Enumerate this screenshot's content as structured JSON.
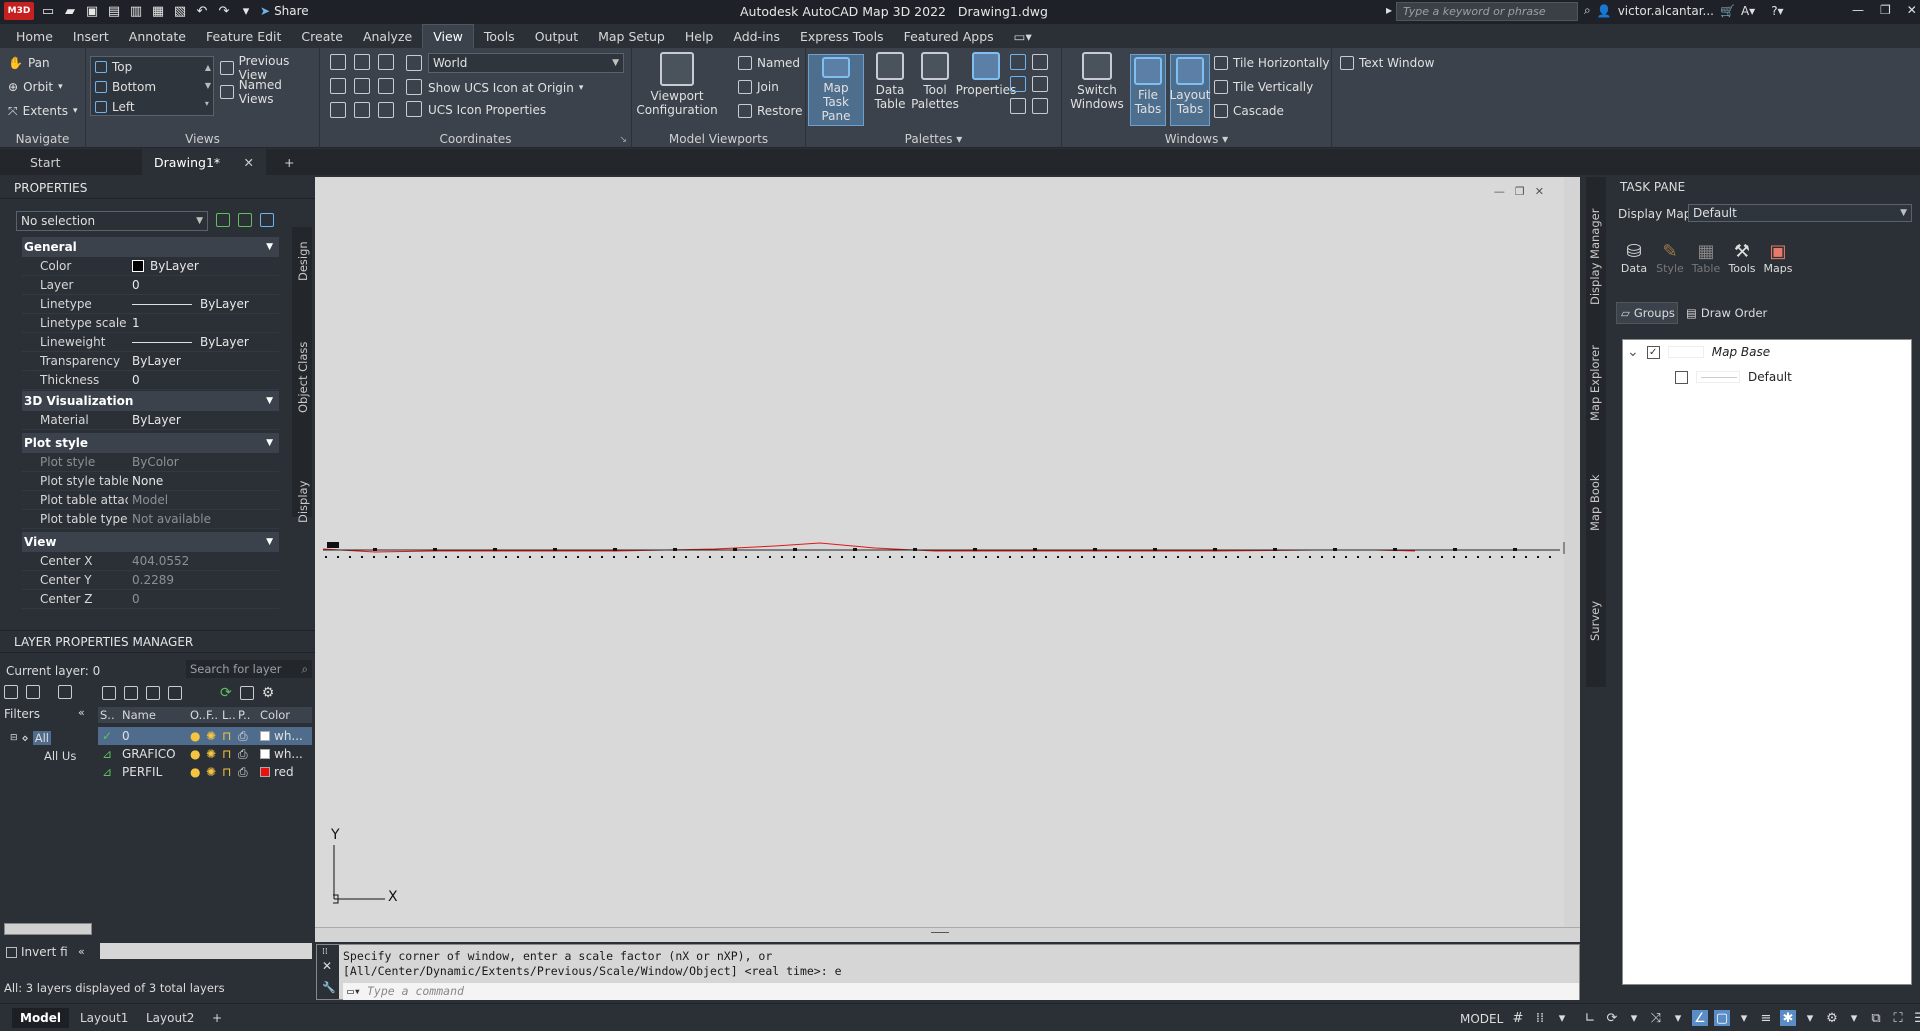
{
  "title_bar": {
    "logo": "M3D",
    "share_label": "Share",
    "window_title": "Autodesk AutoCAD Map 3D 2022",
    "file_name": "Drawing1.dwg",
    "search_placeholder": "Type a keyword or phrase",
    "user_name": "victor.alcantar..."
  },
  "menu": {
    "items": [
      "Home",
      "Insert",
      "Annotate",
      "Feature Edit",
      "Create",
      "Analyze",
      "View",
      "Tools",
      "Output",
      "Map Setup",
      "Help",
      "Add-ins",
      "Express Tools",
      "Featured Apps"
    ],
    "active": "View"
  },
  "ribbon": {
    "navigate": {
      "title": "Navigate",
      "pan": "Pan",
      "orbit": "Orbit",
      "extents": "Extents"
    },
    "views": {
      "title": "Views",
      "list": [
        "Top",
        "Bottom",
        "Left"
      ],
      "previous": "Previous View",
      "named": "Named Views"
    },
    "coordinates": {
      "title": "Coordinates",
      "ucs_value": "World",
      "show_ucs": "Show UCS Icon at Origin",
      "ucs_props": "UCS Icon Properties"
    },
    "model_viewports": {
      "title": "Model Viewports",
      "config": "Viewport Configuration",
      "named": "Named",
      "join": "Join",
      "restore": "Restore"
    },
    "palettes": {
      "title": "Palettes",
      "map_task_pane": "Map Task Pane",
      "data_table": "Data Table",
      "tool_palettes": "Tool Palettes",
      "properties": "Properties"
    },
    "windows": {
      "title": "Windows",
      "switch": "Switch Windows",
      "file_tabs": "File Tabs",
      "layout_tabs": "Layout Tabs",
      "tile_h": "Tile Horizontally",
      "tile_v": "Tile Vertically",
      "cascade": "Cascade",
      "text_window": "Text Window"
    }
  },
  "file_tabs": {
    "start": "Start",
    "active": "Drawing1*"
  },
  "properties": {
    "header": "PROPERTIES",
    "selection": "No selection",
    "side_tabs": [
      "Design",
      "Object Class",
      "Display"
    ],
    "sections": {
      "general": "General",
      "viz": "3D Visualization",
      "plot": "Plot style",
      "view": "View"
    },
    "general": [
      {
        "k": "Color",
        "v": "ByLayer"
      },
      {
        "k": "Layer",
        "v": "0"
      },
      {
        "k": "Linetype",
        "v": "ByLayer"
      },
      {
        "k": "Linetype scale",
        "v": "1"
      },
      {
        "k": "Lineweight",
        "v": "ByLayer"
      },
      {
        "k": "Transparency",
        "v": "ByLayer"
      },
      {
        "k": "Thickness",
        "v": "0"
      }
    ],
    "viz": [
      {
        "k": "Material",
        "v": "ByLayer"
      }
    ],
    "plot": [
      {
        "k": "Plot style",
        "v": "ByColor"
      },
      {
        "k": "Plot style table",
        "v": "None"
      },
      {
        "k": "Plot table attach...",
        "v": "Model"
      },
      {
        "k": "Plot table type",
        "v": "Not available"
      }
    ],
    "view": [
      {
        "k": "Center X",
        "v": "404.0552"
      },
      {
        "k": "Center Y",
        "v": "0.2289"
      },
      {
        "k": "Center Z",
        "v": "0"
      }
    ]
  },
  "layers": {
    "header": "LAYER PROPERTIES MANAGER",
    "current": "Current layer: 0",
    "search_placeholder": "Search for layer",
    "filters_label": "Filters",
    "tree": [
      "All",
      "All Us"
    ],
    "columns": [
      "S..",
      "Name",
      "O..",
      "F..",
      "L..",
      "P..",
      "Color"
    ],
    "rows": [
      {
        "name": "0",
        "color_name": "wh...",
        "swatch": "#ffffff",
        "selected": true
      },
      {
        "name": "GRAFICO",
        "color_name": "wh...",
        "swatch": "#ffffff",
        "selected": false
      },
      {
        "name": "PERFIL",
        "color_name": "red",
        "swatch": "#e81010",
        "selected": false
      }
    ],
    "invert": "Invert fi",
    "status": "All: 3 layers displayed of 3 total layers"
  },
  "canvas": {
    "ucs_y": "Y",
    "ucs_x": "X"
  },
  "command": {
    "history_1": "Specify corner of window, enter a scale factor (nX or nXP), or",
    "history_2": "[All/Center/Dynamic/Extents/Previous/Scale/Window/Object] <real time>: e",
    "placeholder": "Type a command"
  },
  "task_pane": {
    "header": "TASK PANE",
    "display_map_label": "Display Map:",
    "display_map_value": "Default",
    "tools": [
      "Data",
      "Style",
      "Table",
      "Tools",
      "Maps"
    ],
    "groups": "Groups",
    "draw_order": "Draw Order",
    "tree_root": "Map Base",
    "tree_child": "Default",
    "side_tabs": [
      "Display Manager",
      "Map Explorer",
      "Map Book",
      "Survey"
    ]
  },
  "status_bar": {
    "tabs": [
      "Model",
      "Layout1",
      "Layout2"
    ],
    "model_label": "MODEL"
  },
  "colors": {
    "profile_line": "#e01818",
    "accent": "#5a8dc5"
  }
}
